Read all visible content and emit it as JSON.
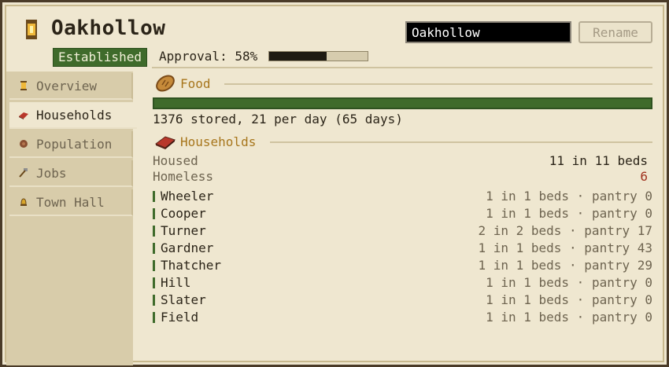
{
  "header": {
    "town_name": "Oakhollow",
    "rename_value": "Oakhollow",
    "rename_button": "Rename",
    "status_badge": "Established",
    "approval_label": "Approval: 58%",
    "approval_percent": 58
  },
  "sidebar": {
    "tabs": [
      {
        "label": "Overview",
        "icon": "lantern-icon"
      },
      {
        "label": "Households",
        "icon": "bed-icon"
      },
      {
        "label": "Population",
        "icon": "person-icon"
      },
      {
        "label": "Jobs",
        "icon": "hammer-icon"
      },
      {
        "label": "Town Hall",
        "icon": "bell-icon"
      }
    ],
    "active": "Households"
  },
  "food": {
    "title": "Food",
    "fill_percent": 100,
    "summary": "1376 stored, 21 per day (65 days)"
  },
  "households": {
    "title": "Households",
    "housed_label": "Housed",
    "housed_value": "11 in 11 beds",
    "homeless_label": "Homeless",
    "homeless_value": "6",
    "list": [
      {
        "name": "Wheeler",
        "detail": "1 in 1 beds · pantry 0"
      },
      {
        "name": "Cooper",
        "detail": "1 in 1 beds · pantry 0"
      },
      {
        "name": "Turner",
        "detail": "2 in 2 beds · pantry 17"
      },
      {
        "name": "Gardner",
        "detail": "1 in 1 beds · pantry 43"
      },
      {
        "name": "Thatcher",
        "detail": "1 in 1 beds · pantry 29"
      },
      {
        "name": "Hill",
        "detail": "1 in 1 beds · pantry 0"
      },
      {
        "name": "Slater",
        "detail": "1 in 1 beds · pantry 0"
      },
      {
        "name": "Field",
        "detail": "1 in 1 beds · pantry 0"
      }
    ]
  },
  "colors": {
    "accent_gold": "#a7761c",
    "green": "#3f6b2b",
    "homeless_red": "#a0321e"
  }
}
